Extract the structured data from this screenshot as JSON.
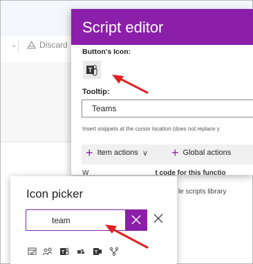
{
  "background": {
    "discard_label": "Discard",
    "scripts_library_text": "le scripts library"
  },
  "editor": {
    "title": "Script editor",
    "icon_label": "Button's Icon:",
    "tooltip_label": "Tooltip:",
    "tooltip_value": "Teams",
    "snippet_note": "Insert snippets at the cursor location (does not replace y",
    "item_actions": "Item actions",
    "global_actions": "Global actions",
    "row2_partial": "W",
    "row2_bold": "t code for this functio"
  },
  "picker": {
    "title": "Icon picker",
    "search_value": "team",
    "result_icons": [
      "calendar-check-icon",
      "people-team-icon",
      "teams-logo-icon",
      "team-small-icon",
      "teams-logo-icon-2",
      "org-chart-icon"
    ]
  },
  "colors": {
    "accent": "#8b1fa9",
    "arrow": "#e02020"
  }
}
